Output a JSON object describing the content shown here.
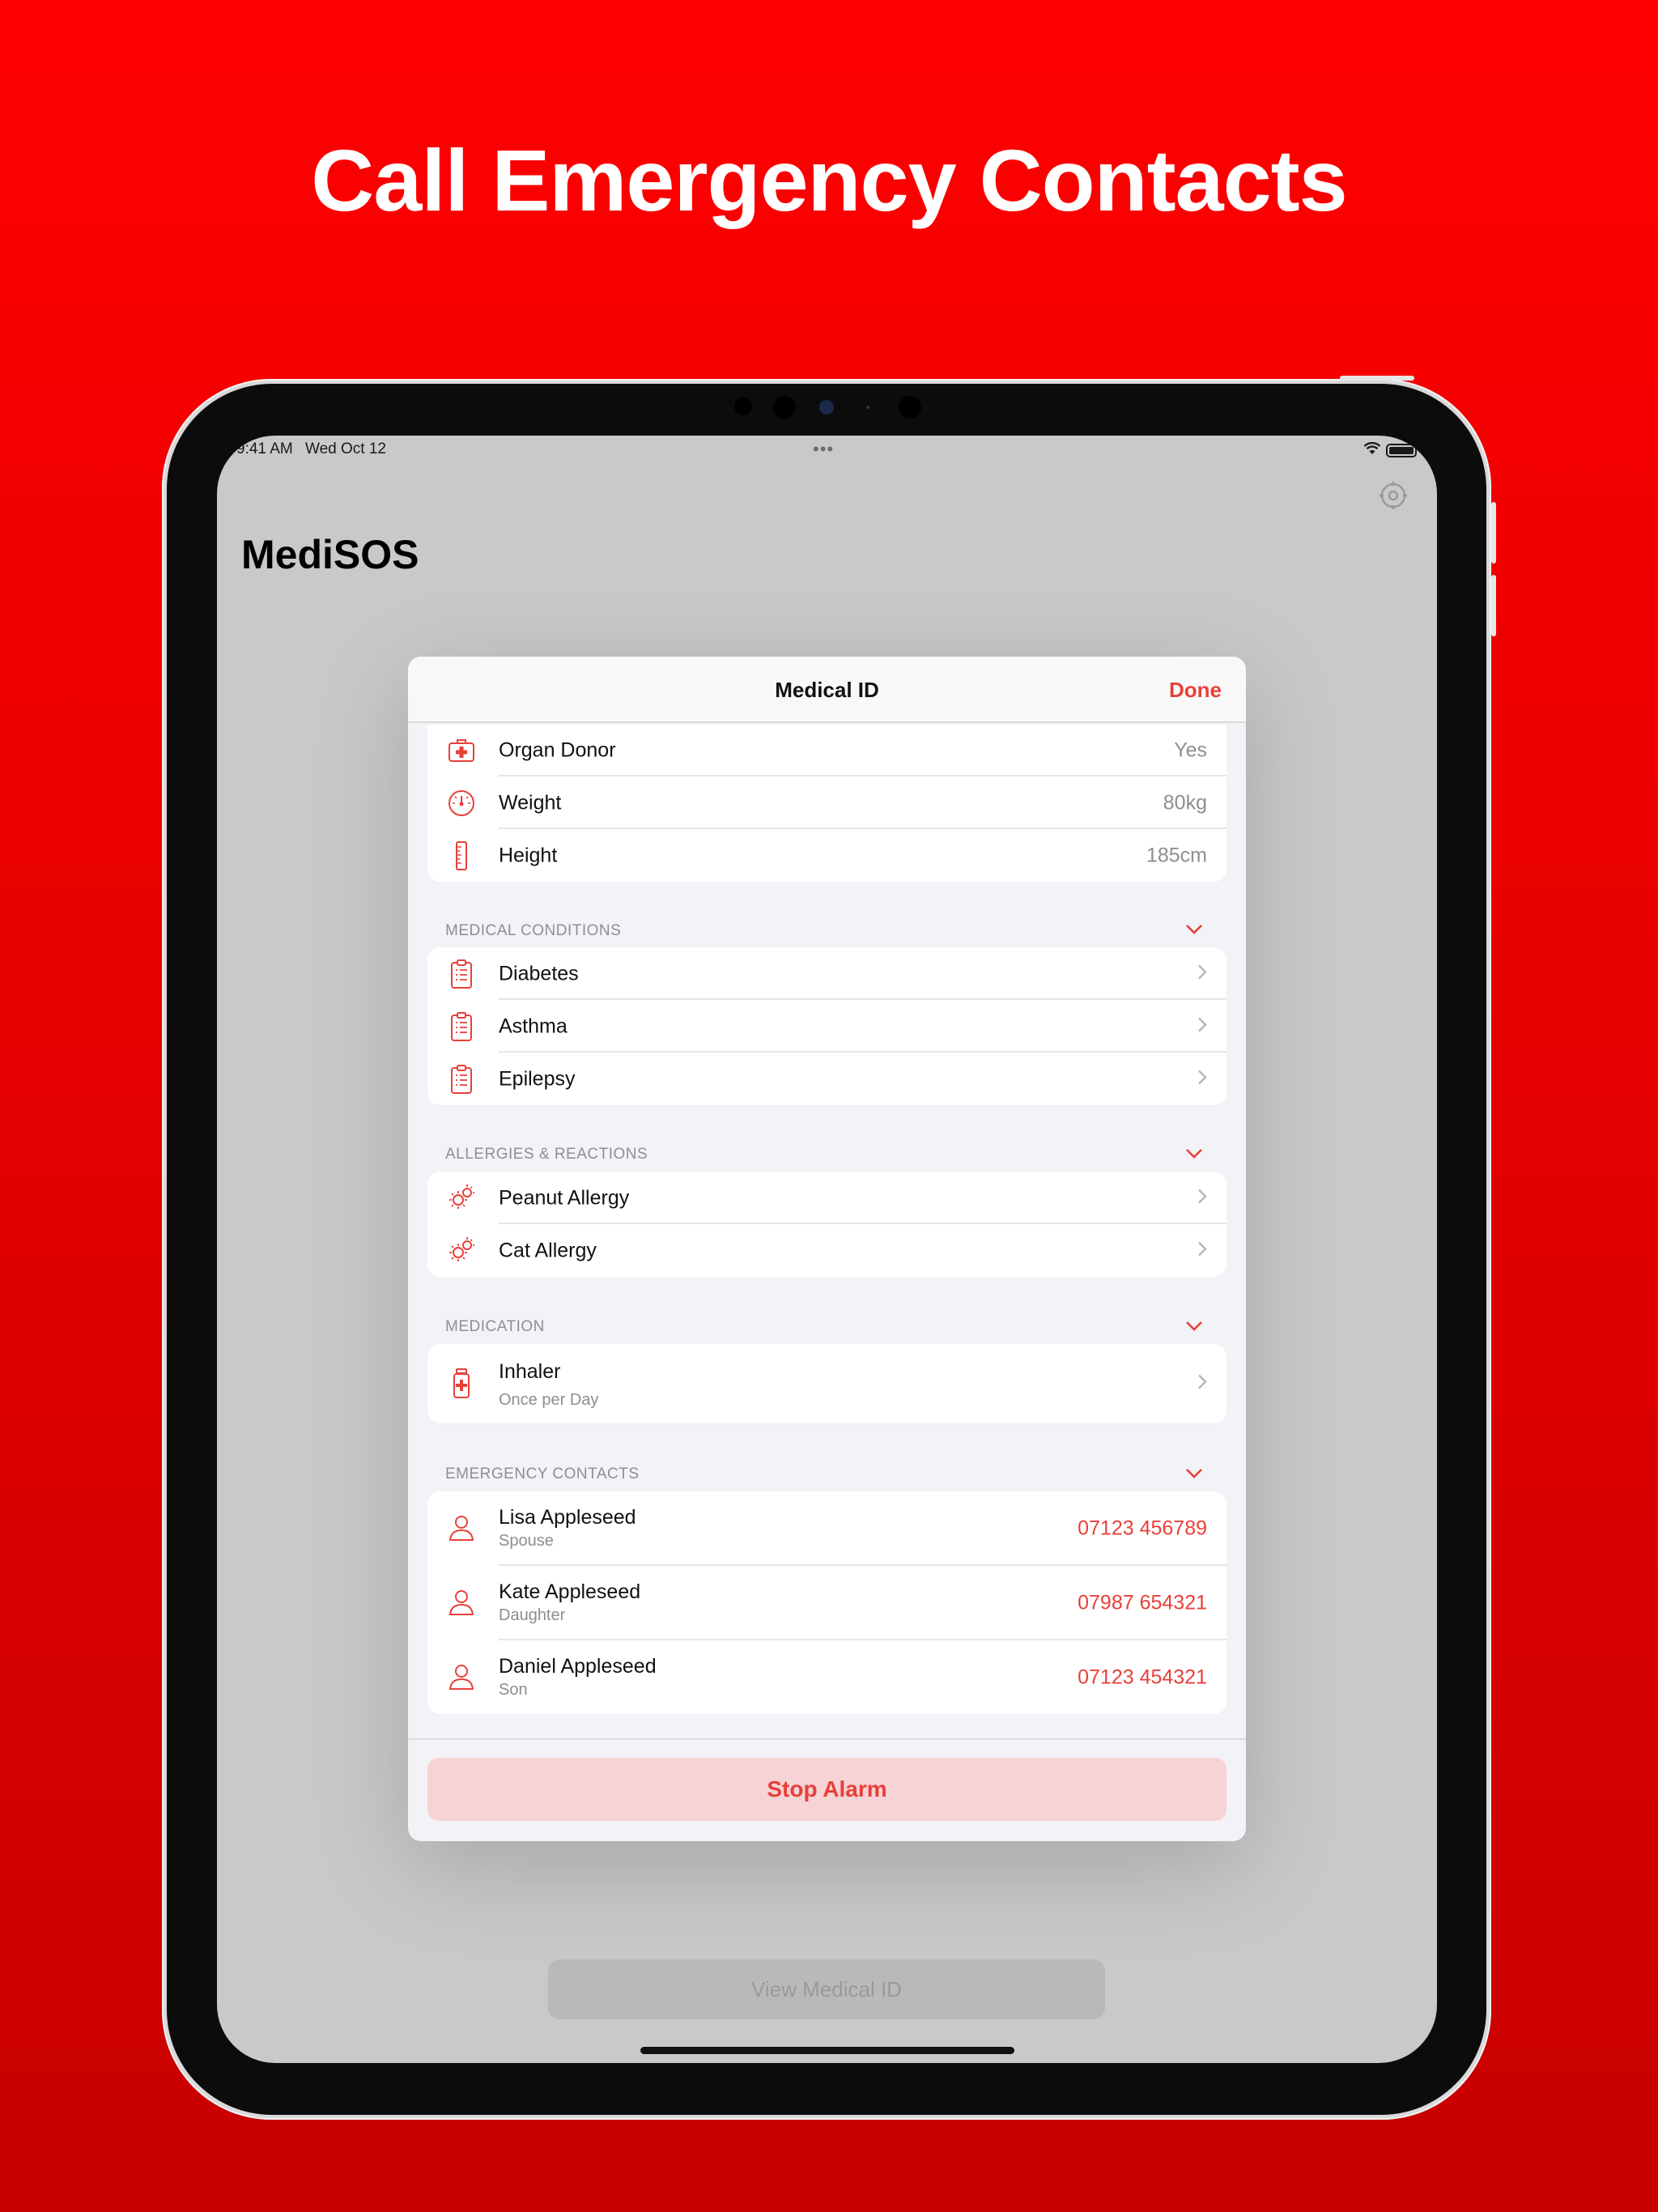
{
  "headline": "Call Emergency Contacts",
  "status_bar": {
    "time": "9:41 AM",
    "date": "Wed Oct 12",
    "dots": "•••"
  },
  "app": {
    "title": "MediSOS",
    "view_button": "View Medical ID"
  },
  "modal": {
    "title": "Medical ID",
    "done": "Done",
    "vitals": [
      {
        "icon": "first-aid-kit-icon",
        "label": "Organ Donor",
        "value": "Yes"
      },
      {
        "icon": "scale-icon",
        "label": "Weight",
        "value": "80kg"
      },
      {
        "icon": "ruler-icon",
        "label": "Height",
        "value": "185cm"
      }
    ],
    "conditions": {
      "header": "MEDICAL CONDITIONS",
      "items": [
        {
          "icon": "clipboard-icon",
          "label": "Diabetes"
        },
        {
          "icon": "clipboard-icon",
          "label": "Asthma"
        },
        {
          "icon": "clipboard-icon",
          "label": "Epilepsy"
        }
      ]
    },
    "allergies": {
      "header": "ALLERGIES & REACTIONS",
      "items": [
        {
          "icon": "allergen-icon",
          "label": "Peanut Allergy"
        },
        {
          "icon": "allergen-icon",
          "label": "Cat Allergy"
        }
      ]
    },
    "medication": {
      "header": "MEDICATION",
      "items": [
        {
          "icon": "medicine-bottle-icon",
          "label": "Inhaler",
          "detail": "Once per Day"
        }
      ]
    },
    "contacts": {
      "header": "EMERGENCY CONTACTS",
      "items": [
        {
          "icon": "person-icon",
          "name": "Lisa Appleseed",
          "relation": "Spouse",
          "phone": "07123 456789"
        },
        {
          "icon": "person-icon",
          "name": "Kate Appleseed",
          "relation": "Daughter",
          "phone": "07987 654321"
        },
        {
          "icon": "person-icon",
          "name": "Daniel Appleseed",
          "relation": "Son",
          "phone": "07123 454321"
        }
      ]
    },
    "stop_button": "Stop Alarm"
  },
  "colors": {
    "accent": "#e8403a",
    "background_top": "#ff0000",
    "background_bottom": "#c70000"
  }
}
